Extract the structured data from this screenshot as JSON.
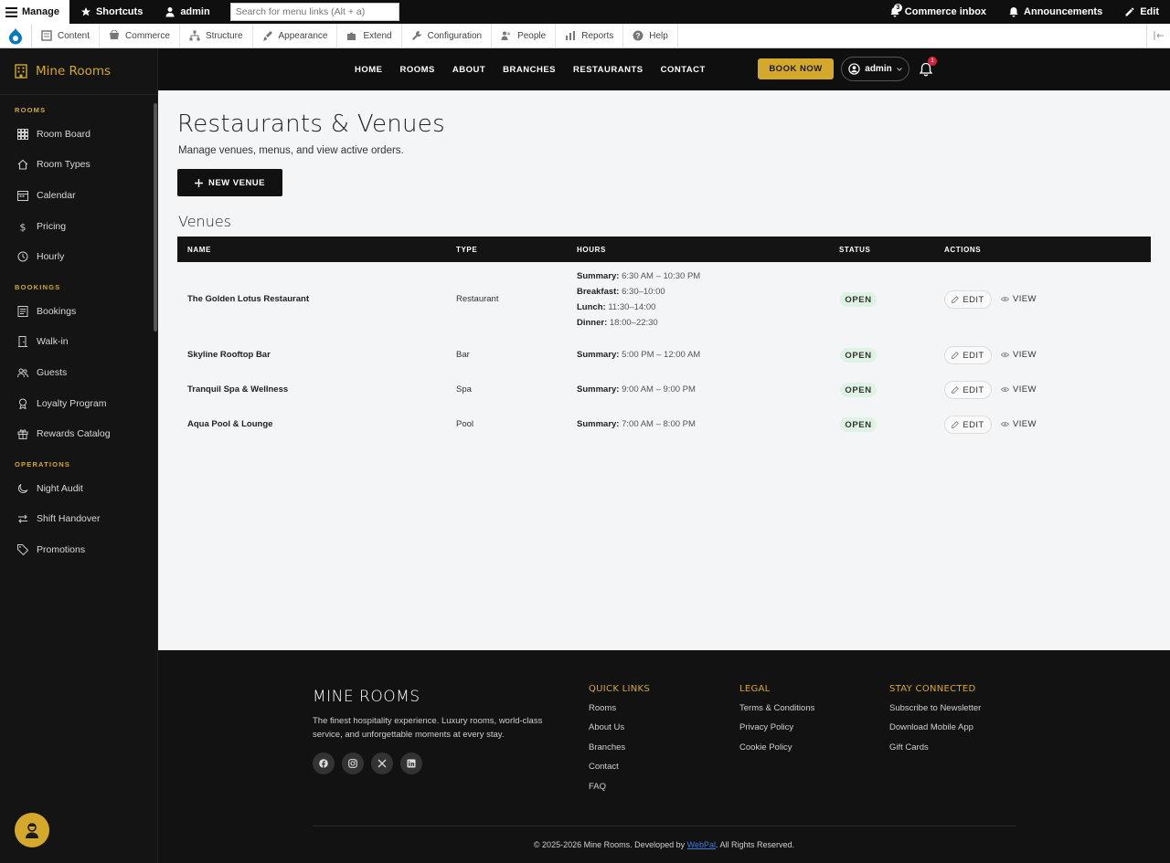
{
  "toolbar": {
    "manage": "Manage",
    "shortcuts": "Shortcuts",
    "user": "admin",
    "search_placeholder": "Search for menu links (Alt + a)",
    "commerce_inbox": "Commerce inbox",
    "inbox_count": "3",
    "announcements": "Announcements",
    "edit": "Edit"
  },
  "tray": {
    "items": [
      "Content",
      "Commerce",
      "Structure",
      "Appearance",
      "Extend",
      "Configuration",
      "People",
      "Reports",
      "Help"
    ]
  },
  "sidebar": {
    "brand": "Mine Rooms",
    "sections": [
      {
        "title": "ROOMS",
        "items": [
          "Room Board",
          "Room Types",
          "Calendar",
          "Pricing",
          "Hourly"
        ]
      },
      {
        "title": "BOOKINGS",
        "items": [
          "Bookings",
          "Walk-in",
          "Guests",
          "Loyalty Program",
          "Rewards Catalog"
        ]
      },
      {
        "title": "OPERATIONS",
        "items": [
          "Night Audit",
          "Shift Handover",
          "Promotions"
        ]
      }
    ]
  },
  "header": {
    "nav": [
      "HOME",
      "ROOMS",
      "ABOUT",
      "BRANCHES",
      "RESTAURANTS",
      "CONTACT"
    ],
    "book_now": "BOOK NOW",
    "user": "admin",
    "notif_count": "1"
  },
  "page": {
    "title": "Restaurants & Venues",
    "subtitle": "Manage venues, menus, and view active orders.",
    "new_venue": "NEW VENUE",
    "section": "Venues"
  },
  "table": {
    "columns": [
      "NAME",
      "TYPE",
      "HOURS",
      "STATUS",
      "ACTIONS"
    ],
    "rows": [
      {
        "name": "The Golden Lotus Restaurant",
        "type": "Restaurant",
        "hours": [
          {
            "label": "Summary:",
            "value": "6:30 AM – 10:30 PM"
          },
          {
            "label": "Breakfast:",
            "value": "6:30–10:00"
          },
          {
            "label": "Lunch:",
            "value": "11:30–14:00"
          },
          {
            "label": "Dinner:",
            "value": "18:00–22:30"
          }
        ],
        "status": "OPEN"
      },
      {
        "name": "Skyline Rooftop Bar",
        "type": "Bar",
        "hours": [
          {
            "label": "Summary:",
            "value": "5:00 PM – 12:00 AM"
          }
        ],
        "status": "OPEN"
      },
      {
        "name": "Tranquil Spa & Wellness",
        "type": "Spa",
        "hours": [
          {
            "label": "Summary:",
            "value": "9:00 AM – 9:00 PM"
          }
        ],
        "status": "OPEN"
      },
      {
        "name": "Aqua Pool & Lounge",
        "type": "Pool",
        "hours": [
          {
            "label": "Summary:",
            "value": "7:00 AM – 8:00 PM"
          }
        ],
        "status": "OPEN"
      }
    ],
    "edit_label": "EDIT",
    "view_label": "VIEW"
  },
  "footer": {
    "brand": "MINE ROOMS",
    "description": "The finest hospitality experience. Luxury rooms, world-class service, and unforgettable moments at every stay.",
    "columns": [
      {
        "title": "QUICK LINKS",
        "links": [
          "Rooms",
          "About Us",
          "Branches",
          "Contact",
          "FAQ"
        ]
      },
      {
        "title": "LEGAL",
        "links": [
          "Terms & Conditions",
          "Privacy Policy",
          "Cookie Policy"
        ]
      },
      {
        "title": "STAY CONNECTED",
        "links": [
          "Subscribe to Newsletter",
          "Download Mobile App",
          "Gift Cards"
        ]
      }
    ],
    "copyright_pre": "© 2025-2026 Mine Rooms. Developed by ",
    "developer": "WebPal",
    "copyright_post": ". All Rights Reserved."
  },
  "colors": {
    "accent": "#d4a82a",
    "status_open_bg": "#dff3e5",
    "status_open_text": "#2f9a54"
  }
}
